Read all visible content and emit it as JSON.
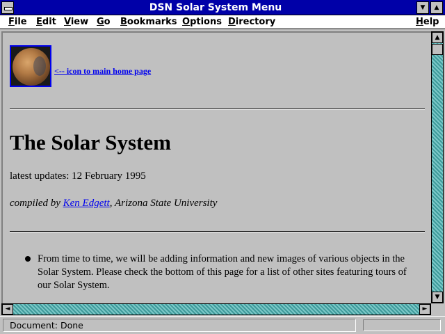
{
  "window": {
    "title": "DSN Solar System Menu",
    "minimize_glyph": "▼",
    "maximize_glyph": "▲"
  },
  "menu": {
    "items": [
      {
        "label": "File",
        "mnemonic": "F",
        "rest": "ile"
      },
      {
        "label": "Edit",
        "mnemonic": "E",
        "rest": "dit"
      },
      {
        "label": "View",
        "mnemonic": "V",
        "rest": "iew"
      },
      {
        "label": "Go",
        "mnemonic": "G",
        "rest": "o"
      },
      {
        "label": "Bookmarks",
        "mnemonic": "B",
        "rest": "ookmarks"
      },
      {
        "label": "Options",
        "mnemonic": "O",
        "rest": "ptions"
      },
      {
        "label": "Directory",
        "mnemonic": "D",
        "rest": "irectory"
      },
      {
        "label": "Help",
        "mnemonic": "H",
        "rest": "elp"
      }
    ]
  },
  "page": {
    "home_link": "<-- icon to main home page",
    "heading": "The Solar System",
    "updates": "latest updates: 12 February 1995",
    "compiled_prefix": "compiled by ",
    "author_link": "Ken Edgett",
    "compiled_suffix": ", Arizona State University",
    "bullet_text": "From time to time, we will be adding information and new images of various objects in the Solar System. Please check the bottom of this page for a list of other sites featuring tours of our Solar System."
  },
  "scrollbars": {
    "up_glyph": "▲",
    "down_glyph": "▼",
    "left_glyph": "◄",
    "right_glyph": "►"
  },
  "status": {
    "text": "Document: Done"
  },
  "colors": {
    "titlebar": "#0000a8",
    "link": "#0000ee",
    "page_bg": "#c0c0c0",
    "scroll_track": "#4aa8a8"
  }
}
